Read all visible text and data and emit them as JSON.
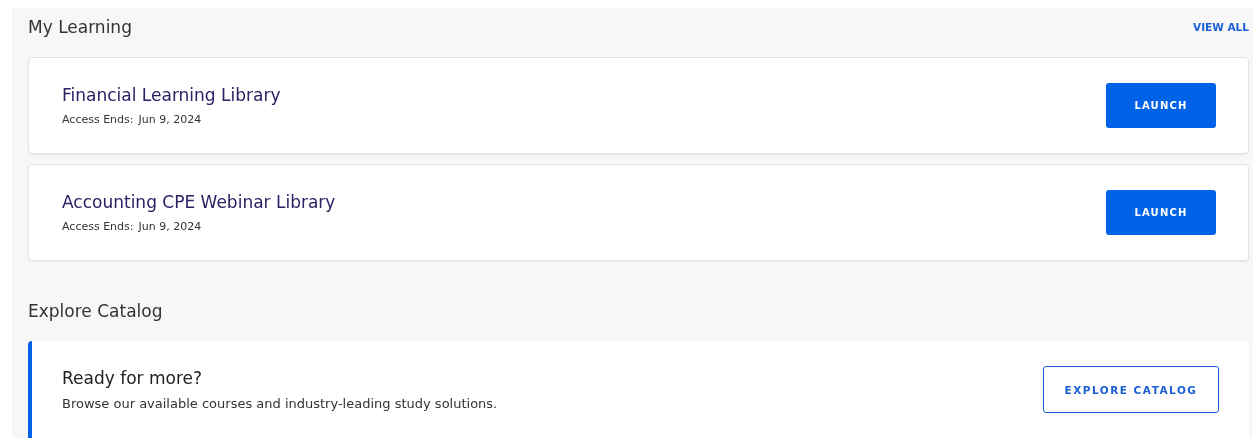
{
  "my_learning": {
    "title": "My Learning",
    "view_all": "VIEW ALL",
    "courses": [
      {
        "title": "Financial Learning Library",
        "access_label": "Access Ends:",
        "access_date": "Jun 9, 2024",
        "button": "LAUNCH"
      },
      {
        "title": "Accounting CPE Webinar Library",
        "access_label": "Access Ends:",
        "access_date": "Jun 9, 2024",
        "button": "LAUNCH"
      }
    ]
  },
  "explore": {
    "title": "Explore Catalog",
    "promo": {
      "heading": "Ready for more?",
      "text": "Browse our available courses and industry-leading study solutions.",
      "button": "EXPLORE CATALOG"
    }
  }
}
